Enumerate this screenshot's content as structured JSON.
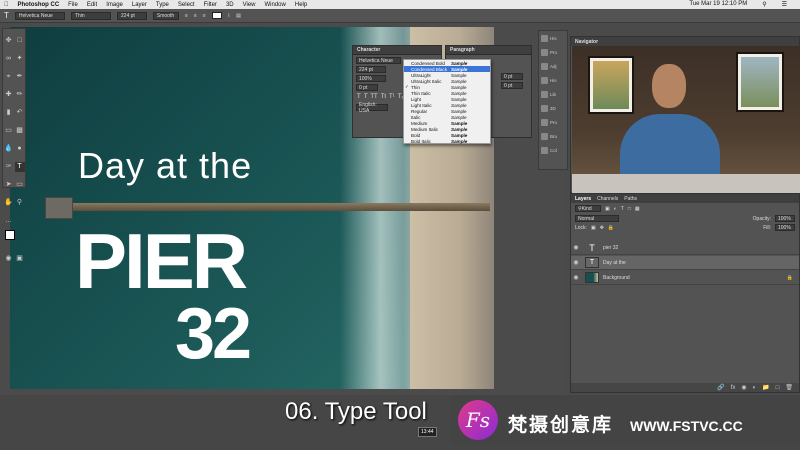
{
  "menubar": {
    "app": "Photoshop CC",
    "items": [
      "File",
      "Edit",
      "Image",
      "Layer",
      "Type",
      "Select",
      "Filter",
      "3D",
      "View",
      "Window",
      "Help"
    ],
    "clock": "Tue Mar 19  12:10 PM"
  },
  "options": {
    "font": "Helvetica Neue",
    "style": "Thin",
    "size": "224 pt",
    "aa": "Smooth"
  },
  "canvas": {
    "line1": "Day at the",
    "line2": "PIER",
    "line3": "32"
  },
  "character": {
    "title": "Character",
    "font": "Helvetica Neue",
    "size": "224 pt",
    "leading": "100%",
    "tracking": "0 pt",
    "language": "English: USA"
  },
  "paragraph": {
    "title": "Paragraph",
    "indent1": "0 pt",
    "indent2": "0 pt"
  },
  "dropdown": {
    "items": [
      {
        "name": "Condensed Bold",
        "sample": "Sample"
      },
      {
        "name": "Condensed Black",
        "sample": "Sample"
      },
      {
        "name": "UltraLight",
        "sample": "Sample"
      },
      {
        "name": "UltraLight Italic",
        "sample": "Sample"
      },
      {
        "name": "Thin",
        "sample": "Sample"
      },
      {
        "name": "Thin Italic",
        "sample": "Sample"
      },
      {
        "name": "Light",
        "sample": "Sample"
      },
      {
        "name": "Light Italic",
        "sample": "Sample"
      },
      {
        "name": "Regular",
        "sample": "Sample"
      },
      {
        "name": "Italic",
        "sample": "Sample"
      },
      {
        "name": "Medium",
        "sample": "Sample"
      },
      {
        "name": "Medium Italic",
        "sample": "Sample"
      },
      {
        "name": "Bold",
        "sample": "Sample"
      },
      {
        "name": "Bold Italic",
        "sample": "Sample"
      }
    ]
  },
  "strip": [
    "His",
    "Pro",
    "Adj",
    "His",
    "Lib",
    "3D",
    "Pro",
    "Bru",
    "Col"
  ],
  "navigator": {
    "title": "Navigator"
  },
  "layers": {
    "tabs": [
      "Layers",
      "Channels",
      "Paths"
    ],
    "kind": "Kind",
    "blend": "Normal",
    "opacity_label": "Opacity:",
    "opacity": "100%",
    "lock_label": "Lock:",
    "fill_label": "Fill:",
    "fill": "100%",
    "rows": [
      {
        "name": "pier 32",
        "thumb": "T"
      },
      {
        "name": "Day at the",
        "thumb": "T"
      },
      {
        "name": "Background",
        "thumb": ""
      }
    ]
  },
  "caption": "06. Type Tool",
  "timecode": "13:44",
  "watermark": {
    "cn": "梵摄创意库",
    "url": "WWW.FSTVC.CC",
    "logo": "Fs"
  }
}
